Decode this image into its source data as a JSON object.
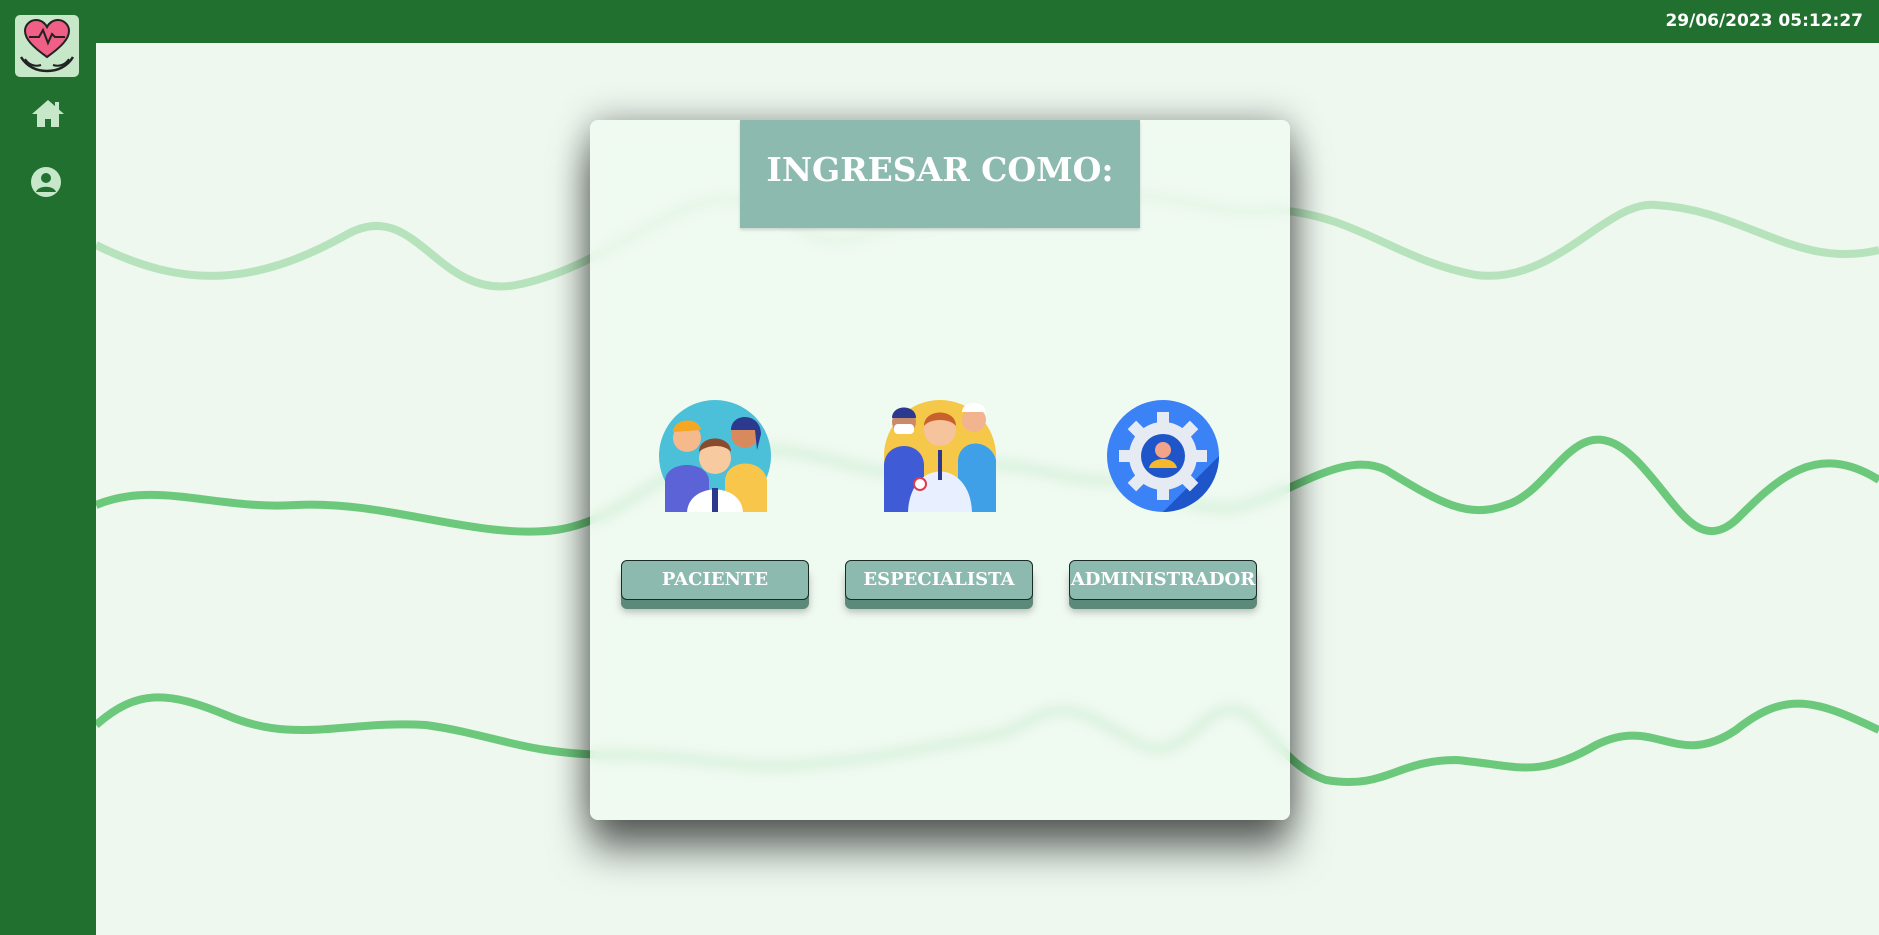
{
  "header": {
    "datetime": "29/06/2023 05:12:27"
  },
  "sidebar": {
    "logo": "heart-hands-logo",
    "items": [
      {
        "icon": "home-icon"
      },
      {
        "icon": "user-circle-icon"
      }
    ]
  },
  "modal": {
    "title": "INGRESAR COMO:",
    "roles": [
      {
        "label": "PACIENTE",
        "image": "patients-group-icon"
      },
      {
        "label": "ESPECIALISTA",
        "image": "medical-staff-icon"
      },
      {
        "label": "ADMINISTRADOR",
        "image": "admin-gear-icon"
      }
    ]
  },
  "colors": {
    "sidebar": "#227030",
    "background": "#eef8ef",
    "accent": "#8dbaaf",
    "wave_light": "#b6e3bc",
    "wave": "#6cc97c"
  }
}
